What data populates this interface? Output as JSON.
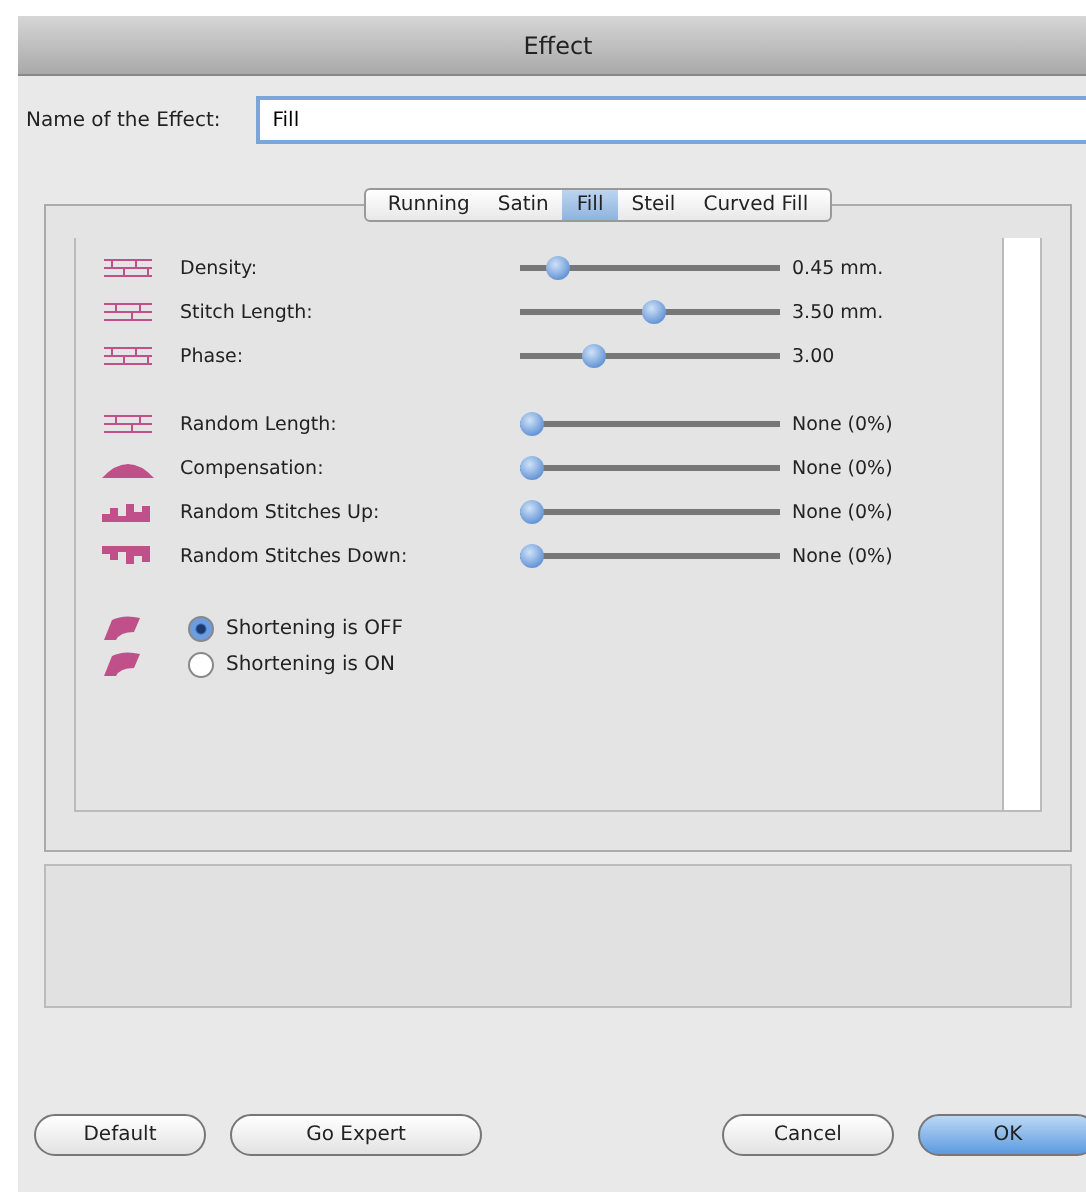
{
  "window": {
    "title": "Effect"
  },
  "name_field": {
    "label": "Name of the Effect:",
    "value": "Fill"
  },
  "tabs": [
    {
      "label": "Running",
      "selected": false
    },
    {
      "label": "Satin",
      "selected": false
    },
    {
      "label": "Fill",
      "selected": true
    },
    {
      "label": "Steil",
      "selected": false
    },
    {
      "label": "Curved Fill",
      "selected": false
    }
  ],
  "settings": [
    {
      "label": "Density:",
      "level": 0.11,
      "reading": "0.45 mm."
    },
    {
      "label": "Stitch Length:",
      "level": 0.52,
      "reading": "3.50 mm."
    },
    {
      "label": "Phase:",
      "level": 0.26,
      "reading": "3.00"
    },
    {
      "label": "Random Length:",
      "level": 0,
      "reading": "None (0%)"
    },
    {
      "label": "Compensation:",
      "level": 0,
      "reading": "None (0%)"
    },
    {
      "label": "Random Stitches Up:",
      "level": 0,
      "reading": "None (0%)"
    },
    {
      "label": "Random Stitches Down:",
      "level": 0,
      "reading": "None (0%)"
    }
  ],
  "shortening": [
    {
      "label": "Shortening is OFF",
      "selected": true
    },
    {
      "label": "Shortening is ON",
      "selected": false
    }
  ],
  "buttons": [
    {
      "label": "Default",
      "kind": "plain"
    },
    {
      "label": "Go Expert",
      "kind": "plain"
    },
    {
      "label": "Cancel",
      "kind": "plain"
    },
    {
      "label": "OK",
      "kind": "default"
    }
  ]
}
